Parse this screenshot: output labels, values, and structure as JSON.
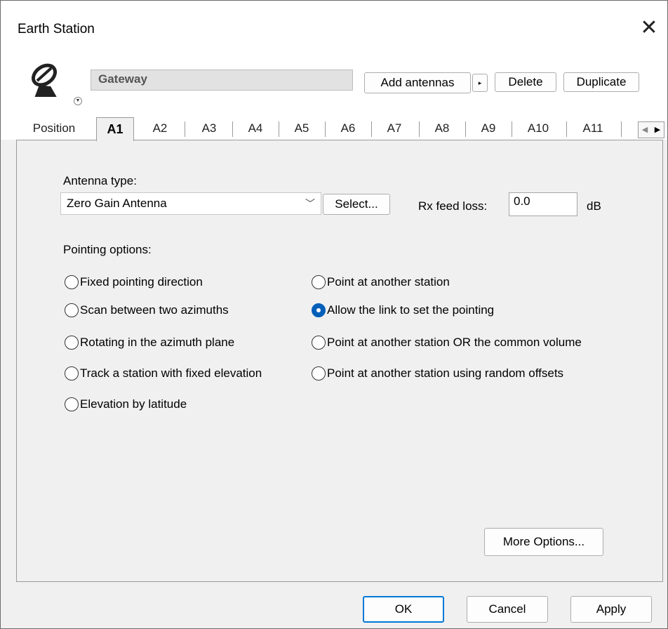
{
  "window": {
    "title": "Earth Station",
    "close_glyph": "✕"
  },
  "header": {
    "icon": "satellite-dish-icon",
    "name_value": "Gateway",
    "add_antennas_label": "Add antennas",
    "add_antennas_arrow": "▸",
    "delete_label": "Delete",
    "duplicate_label": "Duplicate"
  },
  "tabs": {
    "position_label": "Position",
    "active_label": "A1",
    "items": [
      "A2",
      "A3",
      "A4",
      "A5",
      "A6",
      "A7",
      "A8",
      "A9",
      "A10",
      "A11"
    ],
    "scroll_left": "◀",
    "scroll_right": "▶"
  },
  "antenna": {
    "type_label": "Antenna type:",
    "type_value": "Zero Gain Antenna",
    "select_label": "Select...",
    "rx_feed_loss_label": "Rx feed loss:",
    "rx_feed_loss_value": "0.0",
    "rx_feed_loss_unit": "dB"
  },
  "pointing": {
    "label": "Pointing options:",
    "options": [
      "Fixed pointing direction",
      "Point at another station",
      "Scan between two azimuths",
      "Allow the link to set the pointing",
      "Rotating in the azimuth plane",
      "Point at another station OR the common volume",
      "Track a station with fixed elevation",
      "Point at another station using random offsets",
      "Elevation by latitude"
    ],
    "selected": "Allow the link to set the pointing"
  },
  "more_options_label": "More Options...",
  "footer": {
    "ok_label": "OK",
    "cancel_label": "Cancel",
    "apply_label": "Apply"
  },
  "colors": {
    "accent": "#005fb8",
    "dialog_bg": "#f0f0f0",
    "focus_border": "#0078d7"
  }
}
